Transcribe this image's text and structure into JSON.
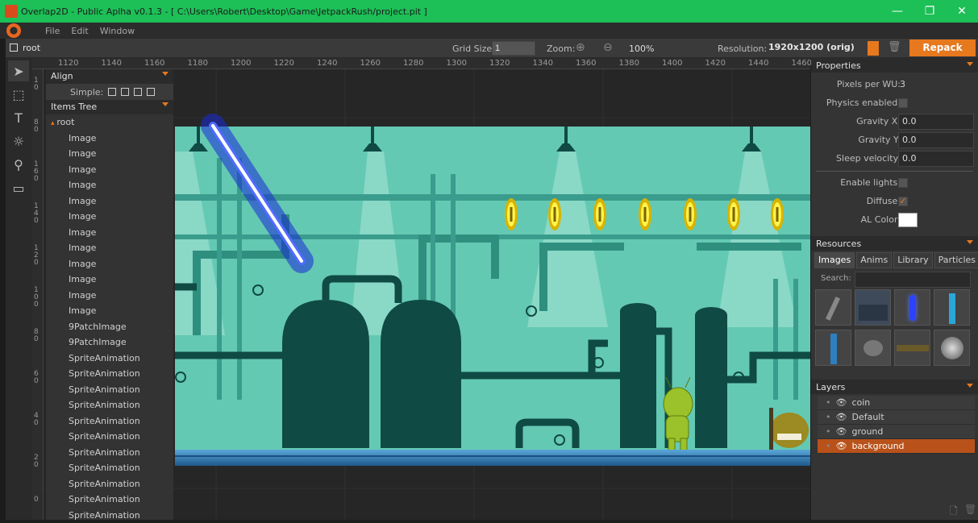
{
  "window": {
    "title": "Overlap2D - Public Aplha v0.1.3 - [ C:\\Users\\Robert\\Desktop\\Game\\JetpackRush/project.pit ]",
    "minimize": "—",
    "restore": "❐",
    "close": "✕"
  },
  "menu": {
    "items": [
      "File",
      "Edit",
      "Window"
    ]
  },
  "toolbar": {
    "scene": "root",
    "grid_size_label": "Grid Size:",
    "grid_size_value": "1",
    "zoom_label": "Zoom:",
    "zoom_value": "100%",
    "resolution_label": "Resolution:",
    "resolution_value": "1920x1200 (orig)",
    "repack_label": "Repack"
  },
  "ruler": {
    "top": [
      "1120",
      "1140",
      "1160",
      "1180",
      "1200",
      "1220",
      "1240",
      "1260",
      "1280",
      "1300",
      "1320",
      "1340",
      "1360",
      "1380",
      "1400",
      "1420",
      "1440",
      "1460"
    ],
    "left": [
      "10",
      "80",
      "160",
      "140",
      "120",
      "100",
      "80",
      "60",
      "40",
      "20",
      "0"
    ]
  },
  "left_panel": {
    "align_title": "Align",
    "simple_label": "Simple:",
    "tree_title": "Items Tree",
    "tree_items": [
      "root",
      "Image",
      "Image",
      "Image",
      "Image",
      "Image",
      "Image",
      "Image",
      "Image",
      "Image",
      "Image",
      "Image",
      "Image",
      "9PatchImage",
      "9PatchImage",
      "SpriteAnimation",
      "SpriteAnimation",
      "SpriteAnimation",
      "SpriteAnimation",
      "SpriteAnimation",
      "SpriteAnimation",
      "SpriteAnimation",
      "SpriteAnimation",
      "SpriteAnimation",
      "SpriteAnimation",
      "SpriteAnimation"
    ]
  },
  "properties": {
    "title": "Properties",
    "pixels_per_wu_label": "Pixels per WU:",
    "pixels_per_wu_value": "3",
    "physics_label": "Physics enabled:",
    "gravity_x_label": "Gravity X:",
    "gravity_x_value": "0.0",
    "gravity_y_label": "Gravity Y:",
    "gravity_y_value": "0.0",
    "sleep_label": "Sleep velocity:",
    "sleep_value": "0.0",
    "lights_label": "Enable lights:",
    "diffuse_label": "Diffuse:",
    "diffuse_check": "✓",
    "al_color_label": "AL Color:",
    "al_color": "#ffffff"
  },
  "resources": {
    "title": "Resources",
    "tabs": [
      "Images",
      "Anims",
      "Library",
      "Particles"
    ],
    "search_label": "Search:"
  },
  "layers": {
    "title": "Layers",
    "items": [
      "coin",
      "Default",
      "ground",
      "background"
    ],
    "selected": "background"
  },
  "colors": {
    "titlebar": "#1dbf57",
    "accent": "#e6781e",
    "scene_bg": "#64c9b3",
    "scene_dark": "#0f4a45"
  }
}
